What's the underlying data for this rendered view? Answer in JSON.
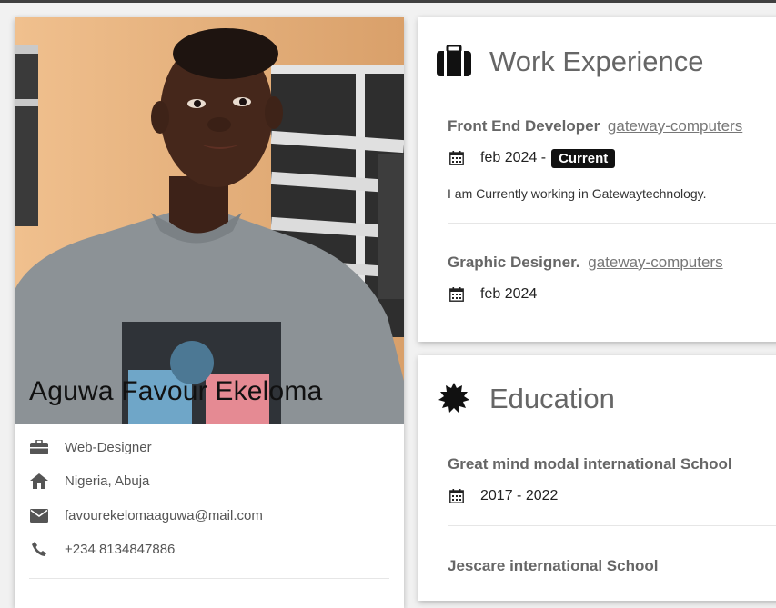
{
  "profile": {
    "name": "Aguwa Favour Ekeloma",
    "photo_icon": "portrait-photo",
    "info": [
      {
        "icon": "briefcase-icon",
        "text": "Web-Designer"
      },
      {
        "icon": "home-icon",
        "text": "Nigeria, Abuja"
      },
      {
        "icon": "envelope-icon",
        "text": "favourekelomaaguwa@mail.com"
      },
      {
        "icon": "phone-icon",
        "text": "+234 8134847886"
      }
    ]
  },
  "work": {
    "title": "Work Experience",
    "icon": "suitcase-icon",
    "entries": [
      {
        "role": "Front End Developer",
        "company": "gateway-computers",
        "date": "feb 2024 -",
        "badge": "Current",
        "description": "I am Currently working in Gatewaytechnology."
      },
      {
        "role": "Graphic Designer.",
        "company": "gateway-computers",
        "date": "feb 2024"
      }
    ]
  },
  "education": {
    "title": "Education",
    "icon": "certificate-icon",
    "entries": [
      {
        "school": "Great mind modal international School",
        "date": "2017 - 2022"
      },
      {
        "school": "Jescare international School"
      }
    ]
  },
  "colors": {
    "page_bg": "#f1f1f1",
    "card_bg": "#ffffff",
    "muted_text": "#666666",
    "badge_bg": "#111111"
  }
}
